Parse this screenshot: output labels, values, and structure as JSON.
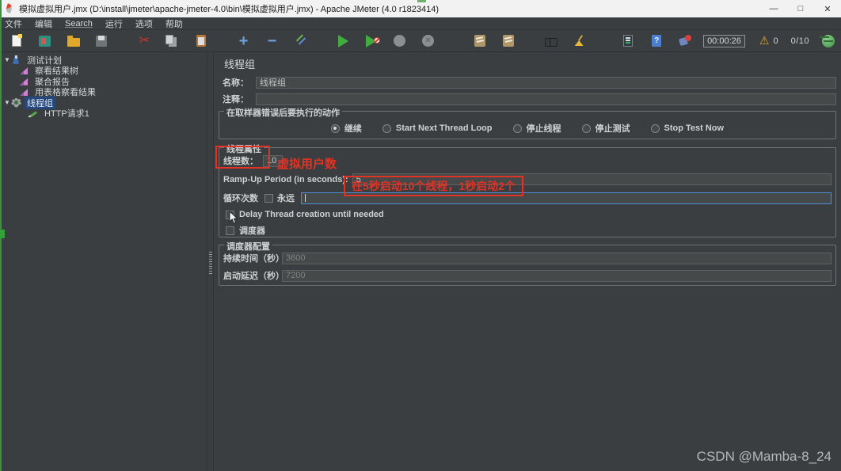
{
  "window": {
    "title": "模拟虚拟用户.jmx (D:\\install\\jmeter\\apache-jmeter-4.0\\bin\\模拟虚拟用户.jmx) - Apache JMeter (4.0 r1823414)",
    "controls": {
      "minimize": "—",
      "maximize": "□",
      "close": "✕"
    }
  },
  "menu": {
    "items": [
      {
        "label": "文件"
      },
      {
        "label": "编辑"
      },
      {
        "label": "Search"
      },
      {
        "label": "运行"
      },
      {
        "label": "选项"
      },
      {
        "label": "帮助"
      }
    ]
  },
  "toolbar": {
    "icon_names": [
      "new-file",
      "templates",
      "open-file",
      "save",
      "cut",
      "copy",
      "paste",
      "expand-all",
      "collapse-all",
      "toggle",
      "start",
      "start-no-pauses",
      "stop",
      "shutdown",
      "clear",
      "clear-all",
      "search",
      "reset-search",
      "function-helper",
      "help",
      "ssl-manager"
    ],
    "glyphs": {
      "cut": "✂",
      "plus": "+",
      "minus": "−",
      "shutdown_x": "✕",
      "help": "?",
      "warning": "⚠"
    },
    "timer": "00:00:26",
    "warning_count": "0",
    "thread_count": "0/10"
  },
  "tree": {
    "items": [
      {
        "label": "测试计划",
        "icon": "test-plan"
      },
      {
        "label": "察看结果树",
        "icon": "listener-chart"
      },
      {
        "label": "聚合报告",
        "icon": "listener-chart"
      },
      {
        "label": "用表格察看结果",
        "icon": "listener-chart"
      },
      {
        "label": "线程组",
        "icon": "thread-group-gear",
        "selected": true
      },
      {
        "label": "HTTP请求1",
        "icon": "http-sampler"
      }
    ],
    "expand_glyph": "▼"
  },
  "main": {
    "title": "线程组",
    "name_label": "名称：",
    "name_value": "线程组",
    "comments_label": "注释：",
    "comments_value": "",
    "error_action": {
      "group_label": "在取样器错误后要执行的动作",
      "options": [
        {
          "label": "继续",
          "selected": true
        },
        {
          "label": "Start Next Thread Loop",
          "selected": false
        },
        {
          "label": "停止线程",
          "selected": false
        },
        {
          "label": "停止测试",
          "selected": false
        },
        {
          "label": "Stop Test Now",
          "selected": false
        }
      ]
    },
    "thread_props": {
      "group_label": "线程属性",
      "threads_label": "线程数：",
      "threads_value": "10",
      "rampup_label": "Ramp-Up Period (in seconds):",
      "rampup_value": "5",
      "loop_label": "循环次数",
      "forever_label": "永远",
      "loop_value": "",
      "delay_creation_label": "Delay Thread creation until needed",
      "scheduler_label": "调度器"
    },
    "scheduler_config": {
      "group_label": "调度器配置",
      "duration_label": "持续时间（秒）",
      "duration_value": "3600",
      "startup_delay_label": "启动延迟（秒）",
      "startup_delay_value": "7200"
    }
  },
  "annotations": {
    "threads_note": "虚拟用户数",
    "rampup_note": "在5秒启动10个线程，1秒启动2个",
    "accent_red": "#e03325"
  },
  "watermark": "CSDN @Mamba-8_24",
  "colors": {
    "selection_blue": "#24477e",
    "panel_bg": "#3b3e40",
    "field_bg": "#45494a",
    "focus_blue": "#4f8fd6",
    "titlebar_bg": "#f2f2f2"
  }
}
